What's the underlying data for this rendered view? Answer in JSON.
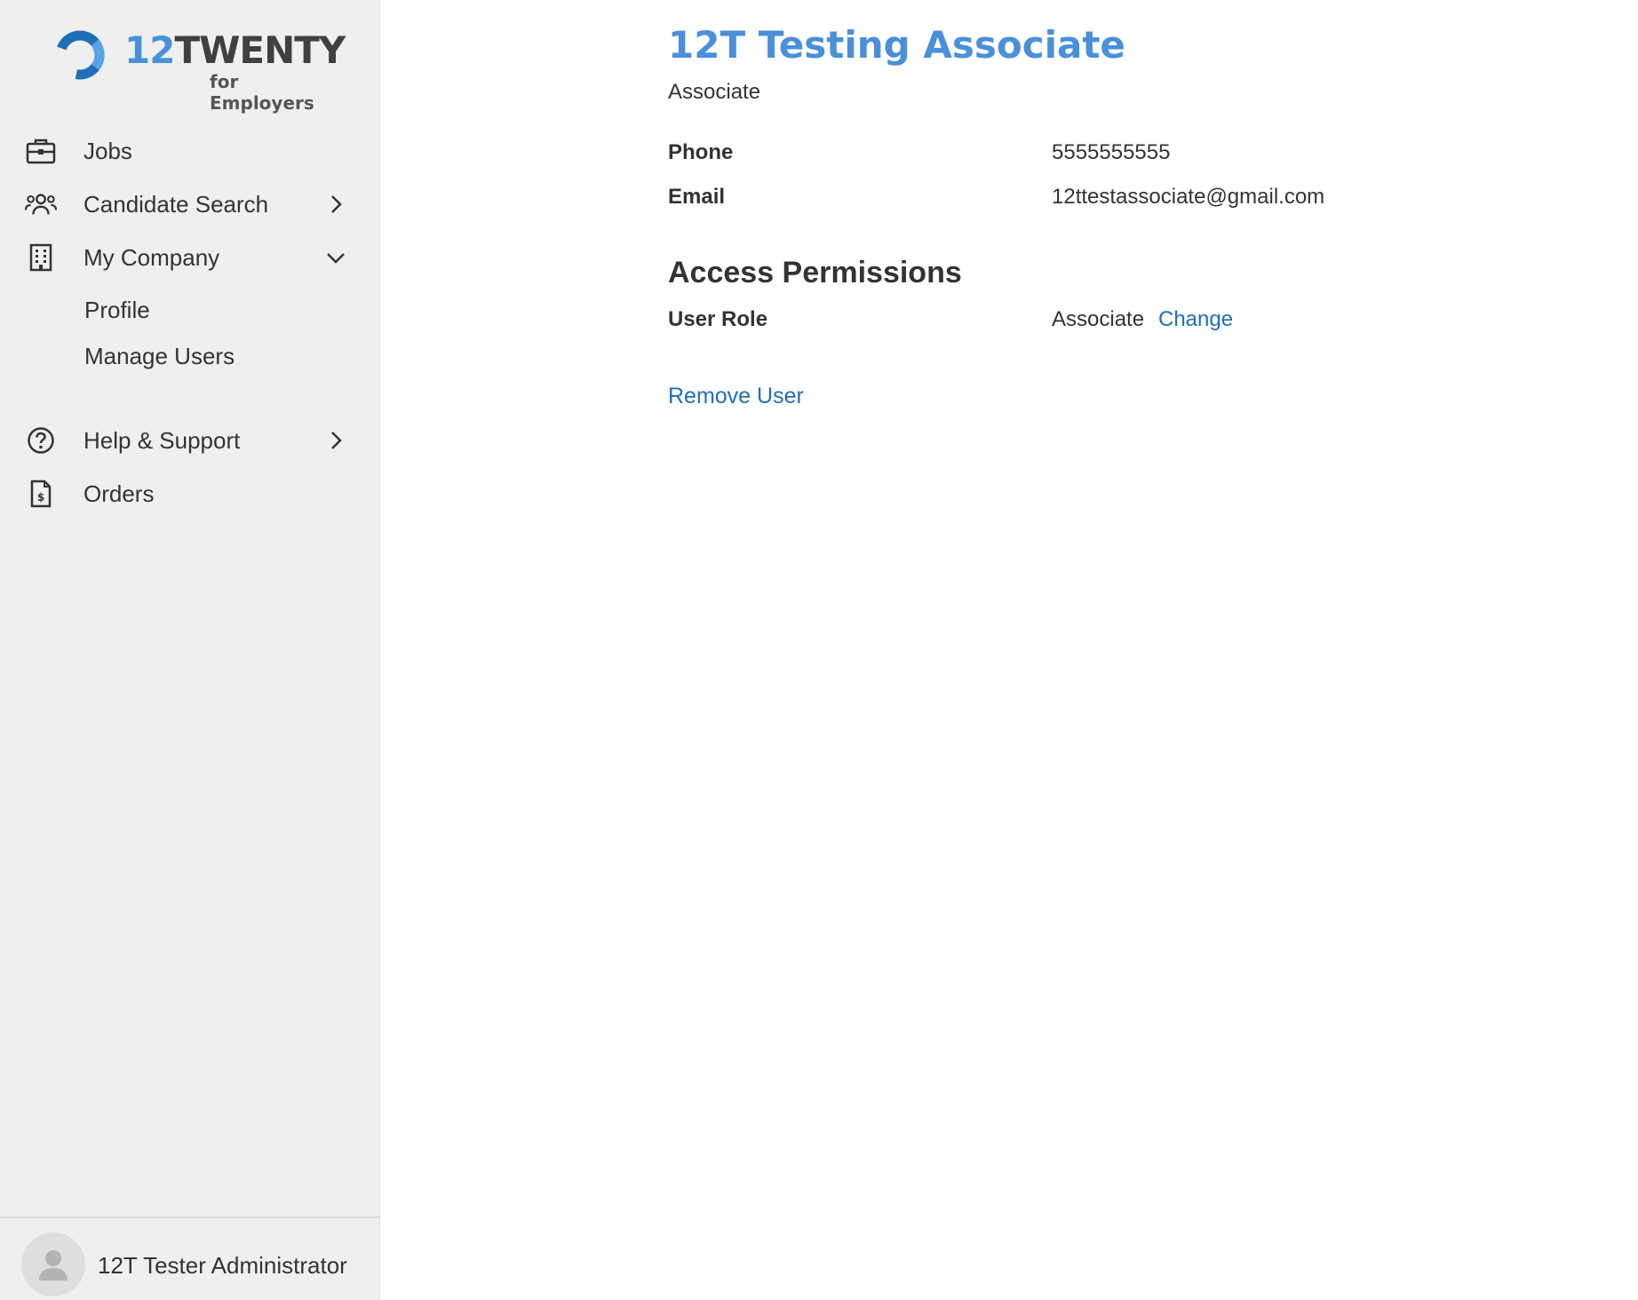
{
  "brand": {
    "logo_number": "12",
    "logo_word": "TWENTY",
    "logo_sub": "for Employers",
    "accent_color": "#4a90d9"
  },
  "sidebar": {
    "items": [
      {
        "label": "Jobs",
        "icon": "briefcase-icon"
      },
      {
        "label": "Candidate Search",
        "icon": "users-icon",
        "chevron": "chevron-right-icon"
      },
      {
        "label": "My Company",
        "icon": "building-icon",
        "chevron": "chevron-down-icon",
        "expanded": true
      },
      {
        "label": "Help & Support",
        "icon": "question-circle-icon",
        "chevron": "chevron-right-icon"
      },
      {
        "label": "Orders",
        "icon": "invoice-icon"
      }
    ],
    "subitems": [
      {
        "label": "Profile"
      },
      {
        "label": "Manage Users"
      }
    ],
    "footer": {
      "user_name": "12T Tester Administrator",
      "icon": "avatar-icon"
    }
  },
  "main": {
    "title": "12T Testing Associate",
    "subtitle": "Associate",
    "phone": {
      "label": "Phone",
      "value": "5555555555"
    },
    "email": {
      "label": "Email",
      "value": "12ttestassociate@gmail.com"
    },
    "access": {
      "title": "Access Permissions",
      "role_label": "User Role",
      "role_value": "Associate",
      "change_label": "Change"
    },
    "remove_label": "Remove User",
    "link_color": "#1f6fb8"
  }
}
